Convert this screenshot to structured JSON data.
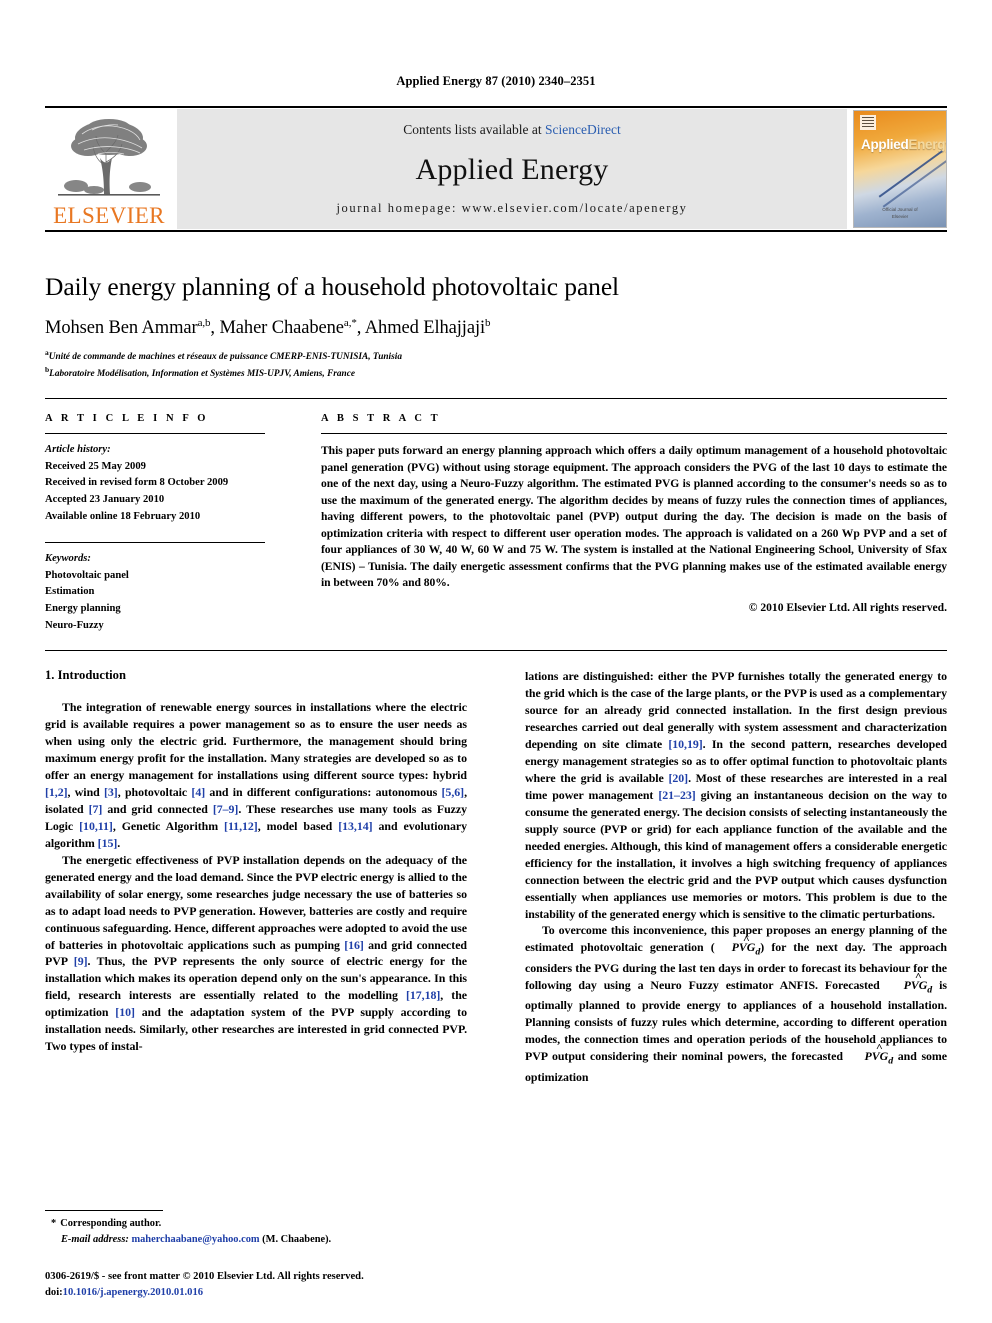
{
  "running_head": "Applied Energy 87 (2010) 2340–2351",
  "masthead": {
    "publisher_name": "ELSEVIER",
    "contents_prefix": "Contents lists available at ",
    "contents_link": "ScienceDirect",
    "journal_title": "Applied Energy",
    "homepage": "journal homepage: www.elsevier.com/locate/apenergy",
    "cover_title_part1": "Applied",
    "cover_title_part2": "Energy",
    "cover_footer": "Official Journal of\nElsevier"
  },
  "article": {
    "title": "Daily energy planning of a household photovoltaic panel",
    "authors": "Mohsen Ben Ammar",
    "author_sup_1": "a,b",
    "author_2": ", Maher Chaabene",
    "author_sup_2": "a,*",
    "author_3": ", Ahmed Elhajjaji",
    "author_sup_3": "b",
    "affiliation_a_sup": "a",
    "affiliation_a": "Unité de commande de machines et réseaux de puissance CMERP-ENIS-TUNISIA, Tunisia",
    "affiliation_b_sup": "b",
    "affiliation_b": "Laboratoire Modélisation, Information et Systèmes MIS-UPJV, Amiens, France"
  },
  "info": {
    "heading": "A R T I C L E  I N F O",
    "history_heading": "Article history:",
    "history": [
      "Received 25 May 2009",
      "Received in revised form 8 October 2009",
      "Accepted 23 January 2010",
      "Available online 18 February 2010"
    ],
    "keywords_heading": "Keywords:",
    "keywords": [
      "Photovoltaic panel",
      "Estimation",
      "Energy planning",
      "Neuro-Fuzzy"
    ]
  },
  "abstract": {
    "heading": "A B S T R A C T",
    "text": "This paper puts forward an energy planning approach which offers a daily optimum management of a household photovoltaic panel generation (PVG) without using storage equipment. The approach considers the PVG of the last 10 days to estimate the one of the next day, using a Neuro-Fuzzy algorithm. The estimated PVG is planned according to the consumer's needs so as to use the maximum of the generated energy. The algorithm decides by means of fuzzy rules the connection times of appliances, having different powers, to the photovoltaic panel (PVP) output during the day. The decision is made on the basis of optimization criteria with respect to different user operation modes. The approach is validated on a 260 Wp PVP and a set of four appliances of 30 W, 40 W, 60 W and 75 W. The system is installed at the National Engineering School, University of Sfax (ENIS) – Tunisia. The daily energetic assessment confirms that the PVG planning makes use of the estimated available energy in between 70% and 80%.",
    "copyright": "© 2010 Elsevier Ltd. All rights reserved."
  },
  "body": {
    "section_title": "1. Introduction",
    "left_p1_a": "The integration of renewable energy sources in installations where the electric grid is available requires a power management so as to ensure the user needs as when using only the electric grid. Furthermore, the management should bring maximum energy profit for the installation. Many strategies are developed so as to offer an energy management for installations using different source types: hybrid ",
    "left_p1_r1": "[1,2]",
    "left_p1_b": ", wind ",
    "left_p1_r2": "[3]",
    "left_p1_c": ", photovoltaic ",
    "left_p1_r3": "[4]",
    "left_p1_d": " and in different configurations: autonomous ",
    "left_p1_r4": "[5,6]",
    "left_p1_e": ", isolated ",
    "left_p1_r5": "[7]",
    "left_p1_f": " and grid connected ",
    "left_p1_r6": "[7–9]",
    "left_p1_g": ". These researches use many tools as Fuzzy Logic ",
    "left_p1_r7": "[10,11]",
    "left_p1_h": ", Genetic Algorithm ",
    "left_p1_r8": "[11,12]",
    "left_p1_i": ", model based ",
    "left_p1_r9": "[13,14]",
    "left_p1_j": " and evolutionary algorithm ",
    "left_p1_r10": "[15]",
    "left_p1_k": ".",
    "left_p2_a": "The energetic effectiveness of PVP installation depends on the adequacy of the generated energy and the load demand. Since the PVP electric energy is allied to the availability of solar energy, some researches judge necessary the use of batteries so as to adapt load needs to PVP generation. However, batteries are costly and require continuous safeguarding. Hence, different approaches were adopted to avoid the use of batteries in photovoltaic applications such as pumping ",
    "left_p2_r1": "[16]",
    "left_p2_b": " and grid connected PVP ",
    "left_p2_r2": "[9]",
    "left_p2_c": ". Thus, the PVP represents the only source of electric energy for the installation which makes its operation depend only on the sun's appearance. In this field, research interests are essentially related to the modelling ",
    "left_p2_r3": "[17,18]",
    "left_p2_d": ", the optimization ",
    "left_p2_r4": "[10]",
    "left_p2_e": " and the adaptation system of the PVP supply according to installation needs. Similarly, other researches are interested in grid connected PVP. Two types of instal-",
    "right_p1_a": "lations are distinguished: either the PVP furnishes totally the generated energy to the grid which is the case of the large plants, or the PVP is used as a complementary source for an already grid connected installation. In the first design previous researches carried out deal generally with system assessment and characterization depending on site climate ",
    "right_p1_r1": "[10,19]",
    "right_p1_b": ". In the second pattern, researches developed energy management strategies so as to offer optimal function to photovoltaic plants where the grid is available ",
    "right_p1_r2": "[20]",
    "right_p1_c": ". Most of these researches are interested in a real time power management ",
    "right_p1_r3": "[21–23]",
    "right_p1_d": " giving an instantaneous decision on the way to consume the generated energy. The decision consists of selecting instantaneously the supply source (PVP or grid) for each appliance function of the available and the needed energies. Although, this kind of management offers a considerable energetic efficiency for the installation, it involves a high switching frequency of appliances connection between the electric grid and the PVP output which causes dysfunction essentially when appliances use memories or motors. This problem is due to the instability of the generated energy which is sensitive to the climatic perturbations.",
    "right_p2_a": "To overcome this inconvenience, this paper proposes an energy planning of the estimated photovoltaic generation (",
    "right_p2_sym1_p": "PV",
    "right_p2_sym1_g": "G",
    "right_p2_sym1_sub": "d",
    "right_p2_b": ") for the next day. The approach considers the PVG during the last ten days in order to forecast its behaviour for the following day using a Neuro Fuzzy estimator ANFIS. Forecasted ",
    "right_p2_c": " is optimally planned to provide energy to appliances of a household installation. Planning consists of fuzzy rules which determine, according to different operation modes, the connection times and operation periods of the household appliances to PVP output considering their nominal powers, the forecasted ",
    "right_p2_d": " and some optimization"
  },
  "footnotes": {
    "corresponding_star": "*",
    "corresponding": "Corresponding author.",
    "email_label": "E-mail address:",
    "email": "maherchaabane@yahoo.com",
    "email_suffix": "(M. Chaabene).",
    "issn_line": "0306-2619/$ - see front matter © 2010 Elsevier Ltd. All rights reserved.",
    "doi_label": "doi:",
    "doi_value": "10.1016/j.apenergy.2010.01.016"
  },
  "colors": {
    "elsevier_orange": "#E87722",
    "link_blue": "#1f3fa8",
    "sciencedirect_blue": "#2a5db0",
    "masthead_gray": "#e6e6e6"
  }
}
